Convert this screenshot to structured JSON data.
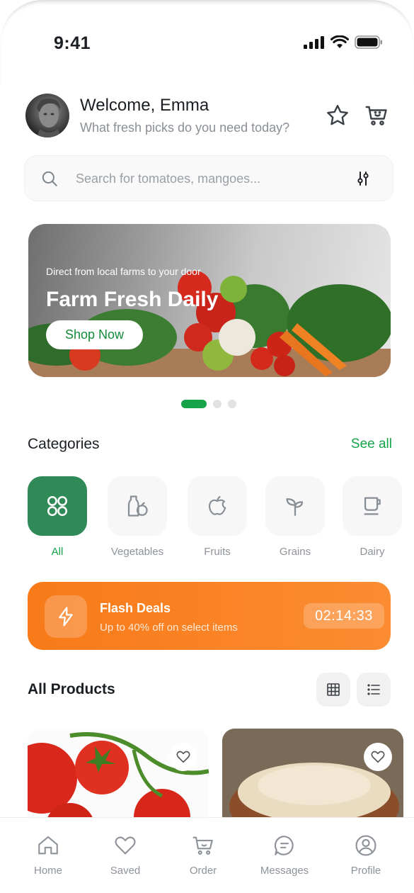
{
  "status": {
    "time": "9:41"
  },
  "header": {
    "greeting": "Welcome, Emma",
    "subtitle": "What fresh picks do you need today?"
  },
  "search": {
    "placeholder": "Search for tomatoes, mangoes..."
  },
  "banner": {
    "subtitle": "Direct from local farms to your door",
    "title": "Farm Fresh Daily",
    "button": "Shop Now",
    "pages": 3,
    "active_page": 1
  },
  "categories": {
    "title": "Categories",
    "see_all": "See all",
    "items": [
      {
        "label": "All",
        "icon": "grid-circles-icon",
        "active": true
      },
      {
        "label": "Vegetables",
        "icon": "vegetables-icon"
      },
      {
        "label": "Fruits",
        "icon": "apple-icon"
      },
      {
        "label": "Grains",
        "icon": "sprout-icon"
      },
      {
        "label": "Dairy",
        "icon": "cup-icon"
      }
    ]
  },
  "flash": {
    "title": "Flash Deals",
    "subtitle": "Up to 40% off on select items",
    "timer": "02:14:33"
  },
  "products": {
    "title": "All Products"
  },
  "tabs": [
    {
      "label": "Home",
      "icon": "home-icon"
    },
    {
      "label": "Saved",
      "icon": "heart-icon"
    },
    {
      "label": "Order",
      "icon": "cart-icon"
    },
    {
      "label": "Messages",
      "icon": "chat-icon"
    },
    {
      "label": "Profile",
      "icon": "profile-icon"
    }
  ],
  "colors": {
    "accent": "#16a34a",
    "flash": "#f87a18",
    "category_active": "#2f8a57"
  }
}
